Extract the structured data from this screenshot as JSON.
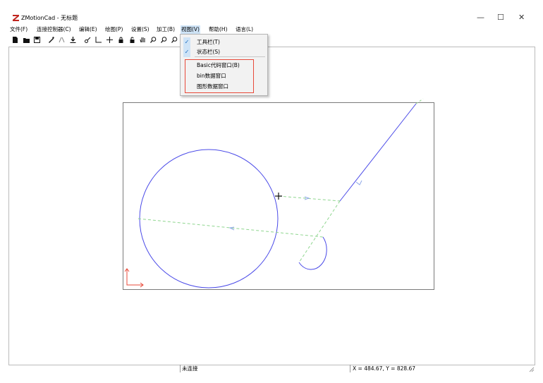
{
  "window": {
    "title": "ZMotionCad - 无标题",
    "minimize_glyph": "—",
    "maximize_glyph": "☐",
    "close_glyph": "✕"
  },
  "menu": {
    "items": [
      {
        "label": "文件(F)"
      },
      {
        "label": "连接控制器(C)"
      },
      {
        "label": "编辑(E)"
      },
      {
        "label": "绘图(P)"
      },
      {
        "label": "设置(S)"
      },
      {
        "label": "加工(B)"
      },
      {
        "label": "视图(V)"
      },
      {
        "label": "帮助(H)"
      },
      {
        "label": "语言(L)"
      }
    ],
    "active": "视图(V)"
  },
  "view_menu": {
    "items": [
      {
        "label": "工具栏(T)",
        "checked": true
      },
      {
        "label": "状态栏(S)",
        "checked": true
      },
      {
        "label": "Basic代码窗口(B)",
        "checked": false
      },
      {
        "label": "bin数据窗口",
        "checked": false
      },
      {
        "label": "图形数据窗口",
        "checked": false
      }
    ],
    "check_glyph": "✓"
  },
  "toolbar": {
    "icons": [
      "new-file-icon",
      "open-folder-icon",
      "save-icon",
      "pen-icon",
      "mirror-icon",
      "download-icon",
      "cursor-icon",
      "axis-icon",
      "crosshair-icon",
      "lock-icon",
      "unlock-icon",
      "pan-hand-icon",
      "zoom-in-icon",
      "zoom-out-icon",
      "zoom-fit-icon"
    ]
  },
  "status": {
    "connection": "未连接",
    "coordinates": "X = 484.67, Y = 828.67"
  },
  "colors": {
    "path_blue": "#4a4ae8",
    "rapid_green": "#8fd68f",
    "axis_red": "#e84a3a",
    "menu_highlight": "#cfe4f7"
  }
}
